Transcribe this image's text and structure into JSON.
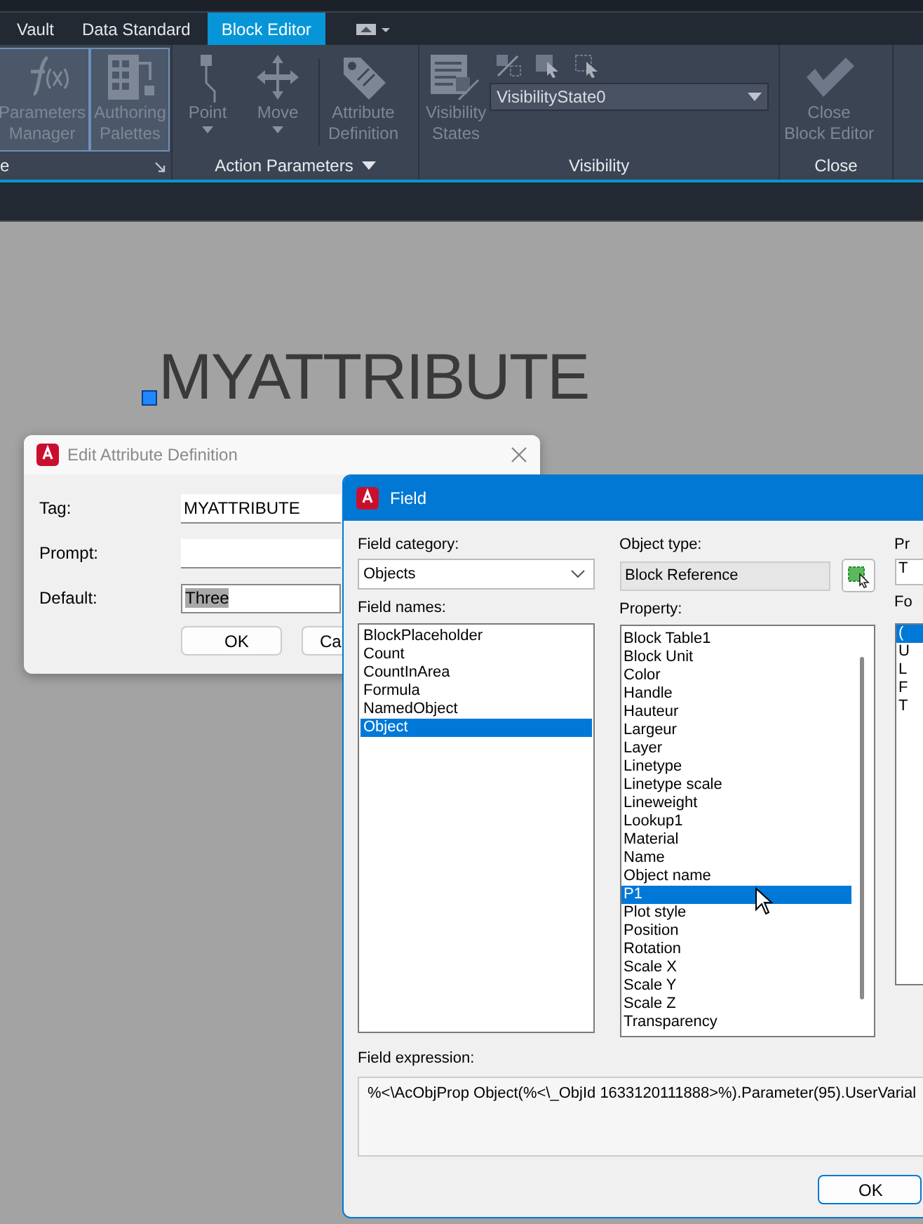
{
  "ribbon_tabs": [
    {
      "label": "Vault",
      "selected": false
    },
    {
      "label": "Data Standard",
      "selected": false
    },
    {
      "label": "Block Editor",
      "selected": true
    }
  ],
  "ribbon_panels": [
    {
      "title": "e",
      "launcher": true,
      "buttons": [
        {
          "label": "Parameters\nManager",
          "kind": "fx",
          "active": true
        },
        {
          "label": "Authoring\nPalettes",
          "kind": "palette",
          "active": true
        }
      ]
    },
    {
      "title": "Action Parameters",
      "has_menu": true,
      "buttons": [
        {
          "label": "Point",
          "kind": "point",
          "active": false,
          "has_menu": true
        },
        {
          "label": "Move",
          "kind": "move",
          "active": false,
          "has_menu": true
        },
        {
          "label": "Attribute\nDefinition",
          "kind": "attribute",
          "active": false
        }
      ]
    },
    {
      "title": "Visibility",
      "buttons": [
        {
          "label": "Visibility\nStates",
          "kind": "visibility",
          "active": false
        }
      ],
      "combo": {
        "value": "VisibilityState0"
      }
    },
    {
      "title": "Close",
      "buttons": [
        {
          "label": "Close\nBlock Editor",
          "kind": "check",
          "active": false
        }
      ]
    }
  ],
  "canvas": {
    "attribute_text": "MYATTRIBUTE"
  },
  "edit_attribute_dialog": {
    "title": "Edit Attribute Definition",
    "fields": [
      {
        "label": "Tag:",
        "value": "MYATTRIBUTE"
      },
      {
        "label": "Prompt:"
      },
      {
        "label": "Default:",
        "value": "Three",
        "text_selected": true
      }
    ],
    "buttons": [
      "OK",
      "Ca"
    ]
  },
  "field_dialog": {
    "title": "Field",
    "field_category_label": "Field category:",
    "field_category": "Objects",
    "field_names_label": "Field names:",
    "field_names": [
      {
        "label": "BlockPlaceholder",
        "selected": false
      },
      {
        "label": "Count",
        "selected": false
      },
      {
        "label": "CountInArea",
        "selected": false
      },
      {
        "label": "Formula",
        "selected": false
      },
      {
        "label": "NamedObject",
        "selected": false
      },
      {
        "label": "Object",
        "selected": true
      }
    ],
    "object_type_label": "Object type:",
    "object_type": "Block Reference",
    "property_label": "Property:",
    "properties": [
      {
        "label": "Block Table1",
        "selected": false
      },
      {
        "label": "Block Unit",
        "selected": false
      },
      {
        "label": "Color",
        "selected": false
      },
      {
        "label": "Handle",
        "selected": false
      },
      {
        "label": "Hauteur",
        "selected": false
      },
      {
        "label": "Largeur",
        "selected": false
      },
      {
        "label": "Layer",
        "selected": false
      },
      {
        "label": "Linetype",
        "selected": false
      },
      {
        "label": "Linetype scale",
        "selected": false
      },
      {
        "label": "Lineweight",
        "selected": false
      },
      {
        "label": "Lookup1",
        "selected": false
      },
      {
        "label": "Material",
        "selected": false
      },
      {
        "label": "Name",
        "selected": false
      },
      {
        "label": "Object name",
        "selected": false
      },
      {
        "label": "P1",
        "selected": true
      },
      {
        "label": "Plot style",
        "selected": false
      },
      {
        "label": "Position",
        "selected": false
      },
      {
        "label": "Rotation",
        "selected": false
      },
      {
        "label": "Scale X",
        "selected": false
      },
      {
        "label": "Scale Y",
        "selected": false
      },
      {
        "label": "Scale Z",
        "selected": false
      },
      {
        "label": "Transparency",
        "selected": false
      }
    ],
    "column_3_label": "Pr",
    "column_3_value": "T",
    "column_3_list_label": "Fo",
    "column_3_items": [
      {
        "label": "(",
        "selected": true
      },
      {
        "label": "U",
        "selected": false
      },
      {
        "label": "L",
        "selected": false
      },
      {
        "label": "F",
        "selected": false
      },
      {
        "label": "T",
        "selected": false
      }
    ],
    "expression_label": "Field expression:",
    "expression": "%<\\AcObjProp Object(%<\\_ObjId 1633120111888>%).Parameter(95).UserVarial",
    "ok": "OK"
  }
}
